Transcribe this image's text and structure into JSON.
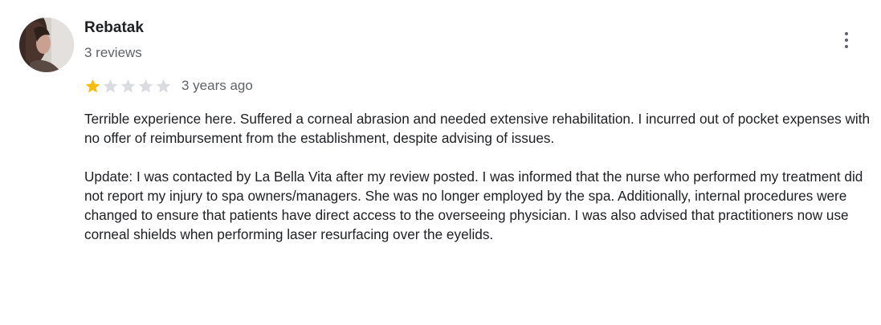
{
  "review": {
    "reviewer": {
      "name": "Rebatak",
      "meta": "3 reviews",
      "avatar_icon": "profile-photo"
    },
    "rating": {
      "value": 1,
      "max": 5,
      "filled_color": "#fbbc04",
      "empty_color": "#dadce0"
    },
    "date": "3 years ago",
    "more_icon": "more-vert-icon",
    "paragraphs": [
      "Terrible experience here. Suffered a corneal abrasion and needed extensive rehabilitation. I incurred out of pocket expenses with no offer of reimbursement from the establishment, despite advising of issues.",
      "Update: I was contacted by La Bella Vita after my review posted. I was informed that the nurse who performed my treatment did not report my injury to spa owners/managers. She was no longer employed by the spa. Additionally, internal procedures were changed to ensure that patients have direct access to the overseeing physician. I was also advised that practitioners now use corneal shields when performing laser resurfacing over the eyelids."
    ]
  }
}
